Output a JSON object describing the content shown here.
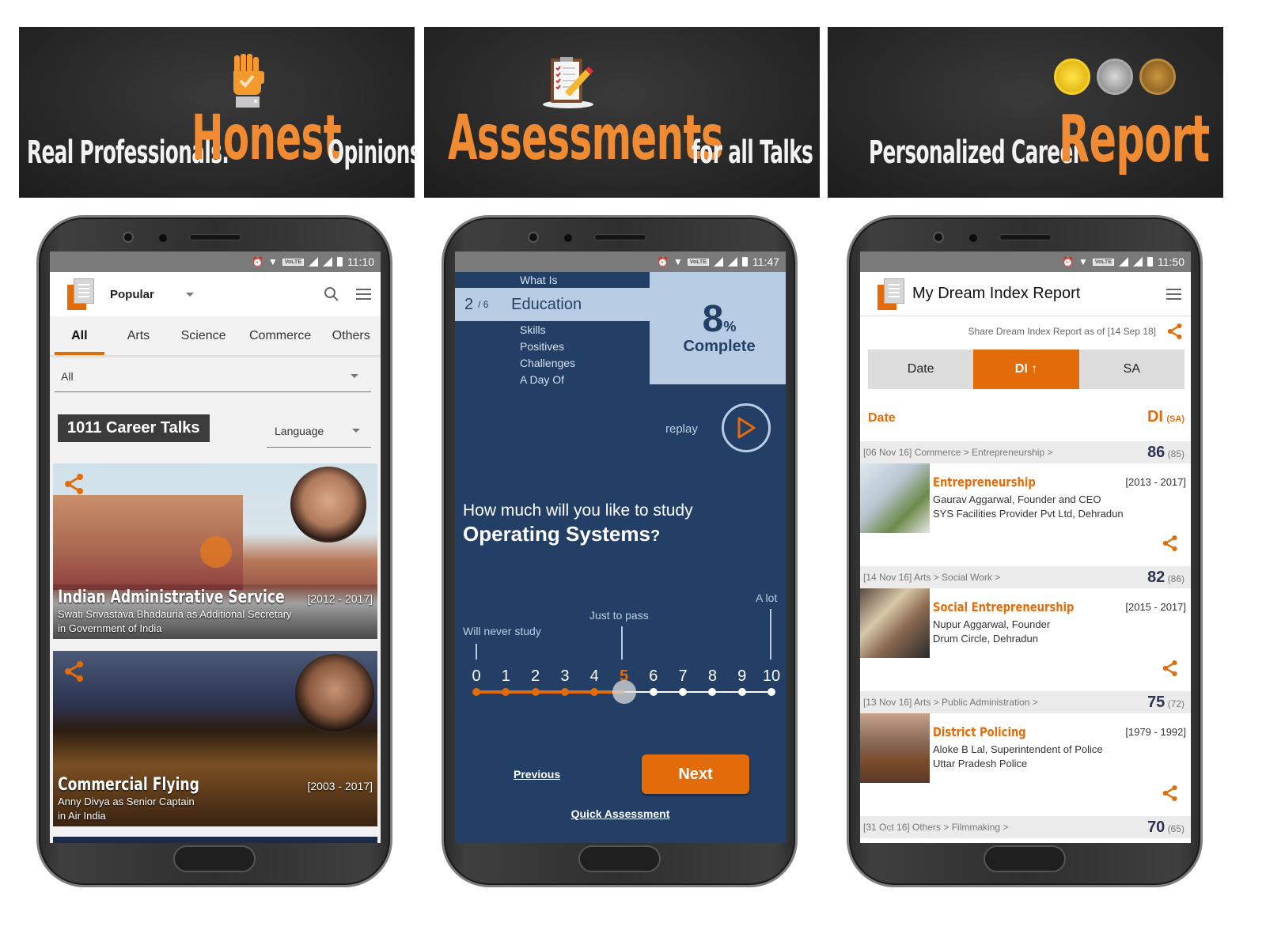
{
  "banners": [
    {
      "pre": "Real Professionals.",
      "highlight": "Honest",
      "post": "Opinions.",
      "icon": "raised-hand-check-icon"
    },
    {
      "pre": "",
      "highlight": "Assessments",
      "post": "for all Talks",
      "icon": "clipboard-pencil-icon"
    },
    {
      "pre": "Personalized  Career",
      "highlight": "Report",
      "post": "",
      "icon": "medals-icon"
    }
  ],
  "phone1": {
    "status_time": "11:10",
    "lte": "VoLTE",
    "dropdown_label": "Popular",
    "tabs": [
      "All",
      "Arts",
      "Science",
      "Commerce",
      "Others"
    ],
    "active_tab": "All",
    "filter_value": "All",
    "talks_count_label": "1011 Career Talks",
    "language_label": "Language",
    "cards": [
      {
        "title": "Indian Administrative Service",
        "years": "[2012 - 2017]",
        "subtitle_line1": "Swati Srivastava Bhadauria as Additional Secretary",
        "subtitle_line2": "in Government of India"
      },
      {
        "title": "Commercial Flying",
        "years": "[2003 - 2017]",
        "subtitle_line1": "Anny Divya as Senior Captain",
        "subtitle_line2": "in Air India"
      }
    ]
  },
  "phone2": {
    "status_time": "11:47",
    "lte": "VoLTE",
    "sections": [
      "What Is",
      "Education",
      "Skills",
      "Positives",
      "Challenges",
      "A Day Of"
    ],
    "current_index": "2",
    "total": "/ 6",
    "current_section": "Education",
    "percent_value": "8",
    "percent_sign": "%",
    "complete_label": "Complete",
    "replay_label": "replay",
    "question_line1": "How much will you like to study",
    "question_subject": "Operating Systems",
    "question_mark": "?",
    "scale_labels": {
      "low": "Will never study",
      "mid": "Just to pass",
      "high": "A lot"
    },
    "scale": [
      "0",
      "1",
      "2",
      "3",
      "4",
      "5",
      "6",
      "7",
      "8",
      "9",
      "10"
    ],
    "selected_value": 5,
    "previous_label": "Previous",
    "next_label": "Next",
    "quick_label": "Quick Assessment"
  },
  "phone3": {
    "status_time": "11:50",
    "lte": "VoLTE",
    "title": "My Dream Index Report",
    "share_text": "Share Dream Index Report as of [14 Sep 18]",
    "sort_tabs": [
      "Date",
      "DI ↑",
      "SA"
    ],
    "active_sort": "DI ↑",
    "col_left": "Date",
    "col_right": "DI",
    "col_right_sub": "(SA)",
    "rows": [
      {
        "path": "[06 Nov 16] Commerce > Entrepreneurship >",
        "di": "86",
        "sa": "(85)",
        "title": "Entrepreneurship",
        "years": "[2013 - 2017]",
        "line1": "Gaurav Aggarwal, Founder and CEO",
        "line2": "SYS Facilities Provider Pvt Ltd, Dehradun"
      },
      {
        "path": "[14 Nov 16] Arts > Social Work >",
        "di": "82",
        "sa": "(86)",
        "title": "Social Entrepreneurship",
        "years": "[2015 - 2017]",
        "line1": "Nupur Aggarwal, Founder",
        "line2": "Drum Circle, Dehradun"
      },
      {
        "path": "[13 Nov 16] Arts > Public Administration >",
        "di": "75",
        "sa": "(72)",
        "title": "District Policing",
        "years": "[1979 - 1992]",
        "line1": "Aloke B Lal, Superintendent of Police",
        "line2": "Uttar Pradesh Police"
      },
      {
        "path": "[31 Oct 16] Others > Filmmaking >",
        "di": "70",
        "sa": "(65)"
      }
    ]
  },
  "colors": {
    "orange": "#e36c0a",
    "navy": "#243f66",
    "light_blue": "#b8cde4"
  }
}
